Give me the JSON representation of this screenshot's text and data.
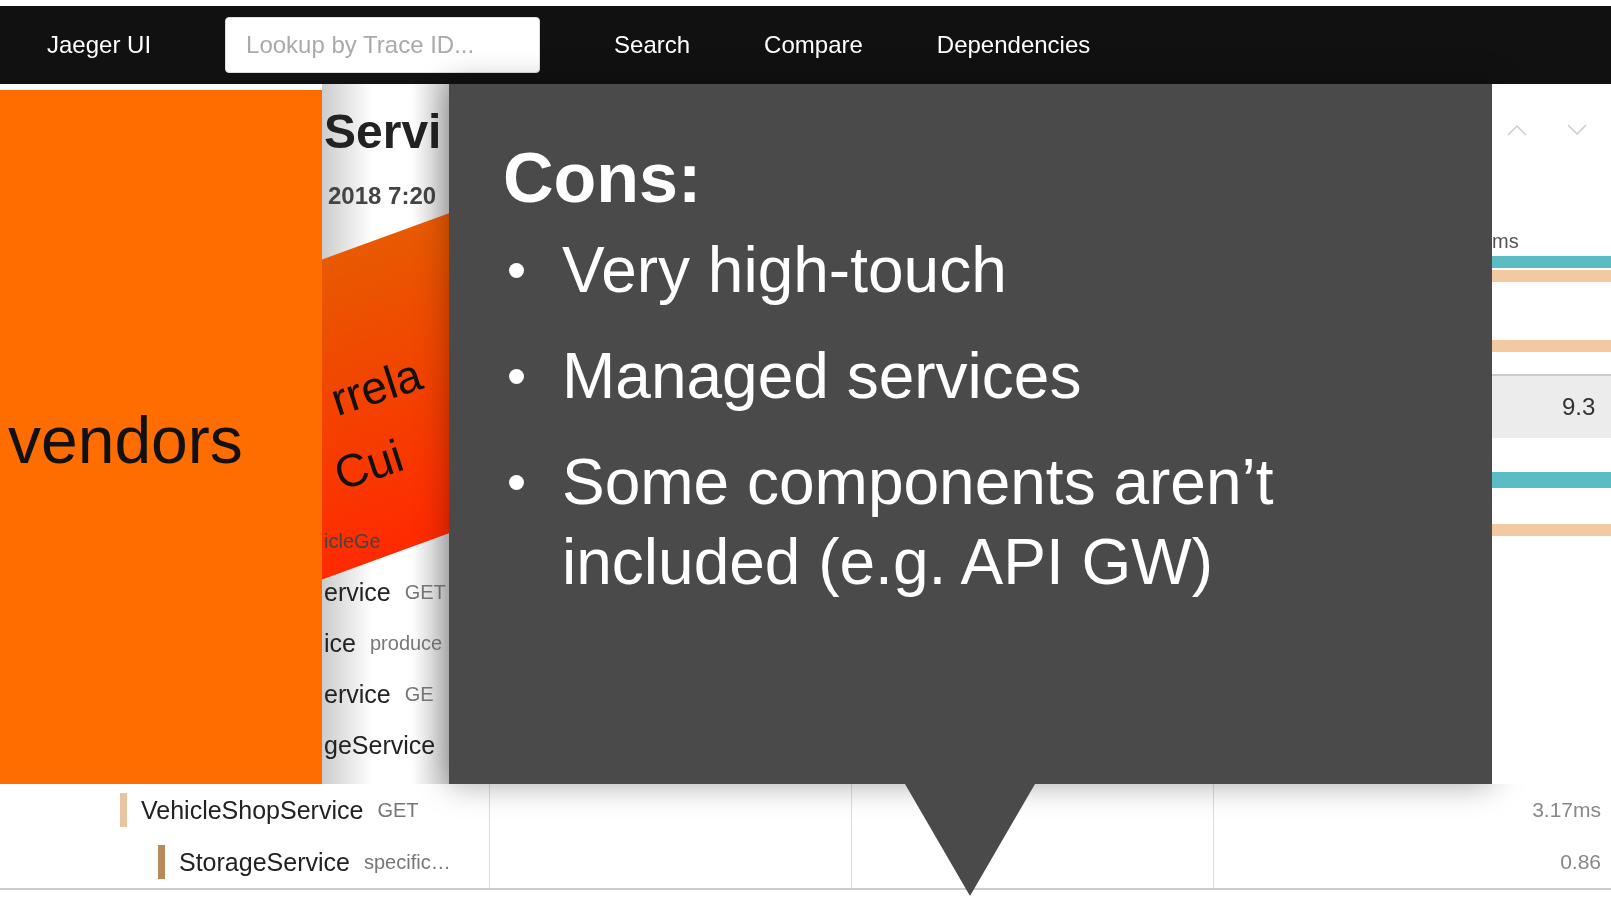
{
  "nav": {
    "brand": "Jaeger UI",
    "search": {
      "placeholder": "Lookup by Trace ID..."
    },
    "links": [
      "Search",
      "Compare",
      "Dependencies"
    ]
  },
  "orange_panel": {
    "text": "vendors"
  },
  "trace": {
    "title_fragment": "Servi",
    "date_fragment": "2018 7:20",
    "banner_lines": [
      "rrela",
      "Cui"
    ],
    "span_rows": [
      {
        "service": "icleGe"
      },
      {
        "service": "ervice",
        "operation": "GET"
      },
      {
        "service": "ice",
        "operation": "produce"
      },
      {
        "service": "ervice",
        "operation": "GE"
      },
      {
        "service": "geService"
      }
    ]
  },
  "callout": {
    "heading": "Cons:",
    "bullets": [
      "Very high-touch",
      "Managed services",
      "Some components aren’t included (e.g. API GW)"
    ]
  },
  "right_strip": {
    "duration": "ms",
    "reading": "9.3",
    "bars": [
      {
        "color": "#5bbcc4"
      },
      {
        "color": "#f2c9a0"
      },
      {
        "color": "#f2c9a0"
      },
      {
        "color": "#5bbcc4"
      },
      {
        "color": "#f2c9a0"
      }
    ]
  },
  "bottom_rows": [
    {
      "service": "VehicleShopService",
      "operation": "GET",
      "duration": "3.17ms",
      "color": "#e8c4a0"
    },
    {
      "service": "StorageService",
      "operation": "specific…",
      "duration": "0.86",
      "color": "#b8895a"
    }
  ]
}
